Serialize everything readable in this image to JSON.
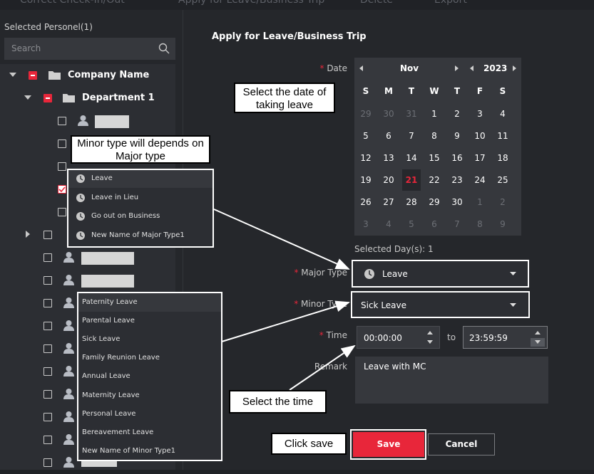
{
  "toolbar": {
    "items": [
      "Correct Check-In/Out",
      "Apply for Leave/Business Trip",
      "Delete",
      "Export"
    ]
  },
  "sidebar": {
    "selected_label": "Selected Personel(1)",
    "search_placeholder": "Search",
    "company": "Company Name",
    "department": "Department 1"
  },
  "form": {
    "title": "Apply for Leave/Business Trip",
    "date_label": "Date",
    "major_type_label": "Major Type",
    "minor_type_label": "Minor Type",
    "time_label": "Time",
    "remark_label": "Remark",
    "major_type_value": "Leave",
    "minor_type_value": "Sick Leave",
    "time_from": "00:00:00",
    "time_to_label": "to",
    "time_to": "23:59:59",
    "remark_value": "Leave with MC",
    "selected_days": "Selected Day(s): 1",
    "save_label": "Save",
    "cancel_label": "Cancel"
  },
  "calendar": {
    "month": "Nov",
    "year": "2023",
    "weekdays": [
      "S",
      "M",
      "T",
      "W",
      "T",
      "F",
      "S"
    ],
    "weeks": [
      [
        "29",
        "30",
        "31",
        "1",
        "2",
        "3",
        "4"
      ],
      [
        "5",
        "6",
        "7",
        "8",
        "9",
        "10",
        "11"
      ],
      [
        "12",
        "13",
        "14",
        "15",
        "16",
        "17",
        "18"
      ],
      [
        "19",
        "20",
        "21",
        "22",
        "23",
        "24",
        "25"
      ],
      [
        "26",
        "27",
        "28",
        "29",
        "30",
        "1",
        "2"
      ],
      [
        "3",
        "4",
        "5",
        "6",
        "7",
        "8",
        "9"
      ]
    ],
    "selected_day": "21"
  },
  "major_types": [
    "Leave",
    "Leave in Lieu",
    "Go out on Business",
    "New Name of Major Type1"
  ],
  "minor_types": [
    "Paternity Leave",
    "Parental Leave",
    "Sick Leave",
    "Family Reunion Leave",
    "Annual Leave",
    "Maternity Leave",
    "Personal Leave",
    "Bereavement Leave",
    "New Name of Minor Type1"
  ],
  "annotations": {
    "select_date": "Select the date of taking leave",
    "minor_depends": "Minor type will depends on Major type",
    "select_time": "Select the time",
    "click_save": "Click save"
  },
  "colors": {
    "accent": "#e8263a",
    "bg": "#25272b",
    "panel": "#2c2e33"
  }
}
